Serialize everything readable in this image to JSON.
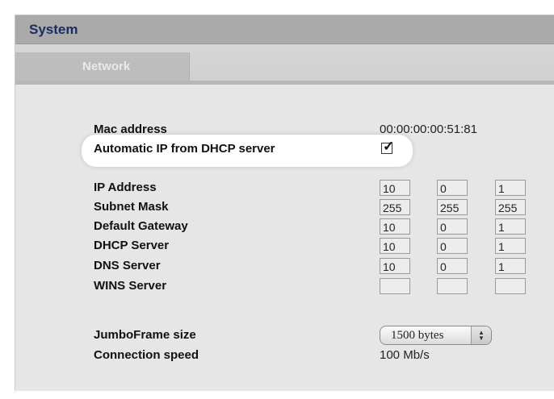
{
  "window": {
    "title": "System"
  },
  "tabs": [
    {
      "label": "Network"
    }
  ],
  "network": {
    "mac": {
      "label": "Mac address",
      "value": "00:00:00:00:51:81"
    },
    "dhcp": {
      "label": "Automatic IP from DHCP server",
      "checked": true,
      "check_glyph": "✓"
    },
    "ip_rows": [
      {
        "label": "IP Address",
        "octets": [
          "10",
          "0",
          "1"
        ]
      },
      {
        "label": "Subnet Mask",
        "octets": [
          "255",
          "255",
          "255"
        ]
      },
      {
        "label": "Default Gateway",
        "octets": [
          "10",
          "0",
          "1"
        ]
      },
      {
        "label": "DHCP Server",
        "octets": [
          "10",
          "0",
          "1"
        ]
      },
      {
        "label": "DNS Server",
        "octets": [
          "10",
          "0",
          "1"
        ]
      },
      {
        "label": "WINS Server",
        "octets": [
          "",
          "",
          ""
        ]
      }
    ],
    "jumbo": {
      "label": "JumboFrame size",
      "selected": "1500 bytes"
    },
    "speed": {
      "label": "Connection speed",
      "value": "100 Mb/s"
    }
  },
  "colors": {
    "title": "#1b2c64",
    "tab_label": "#e9e9e9",
    "highlight": "#ffffff"
  }
}
